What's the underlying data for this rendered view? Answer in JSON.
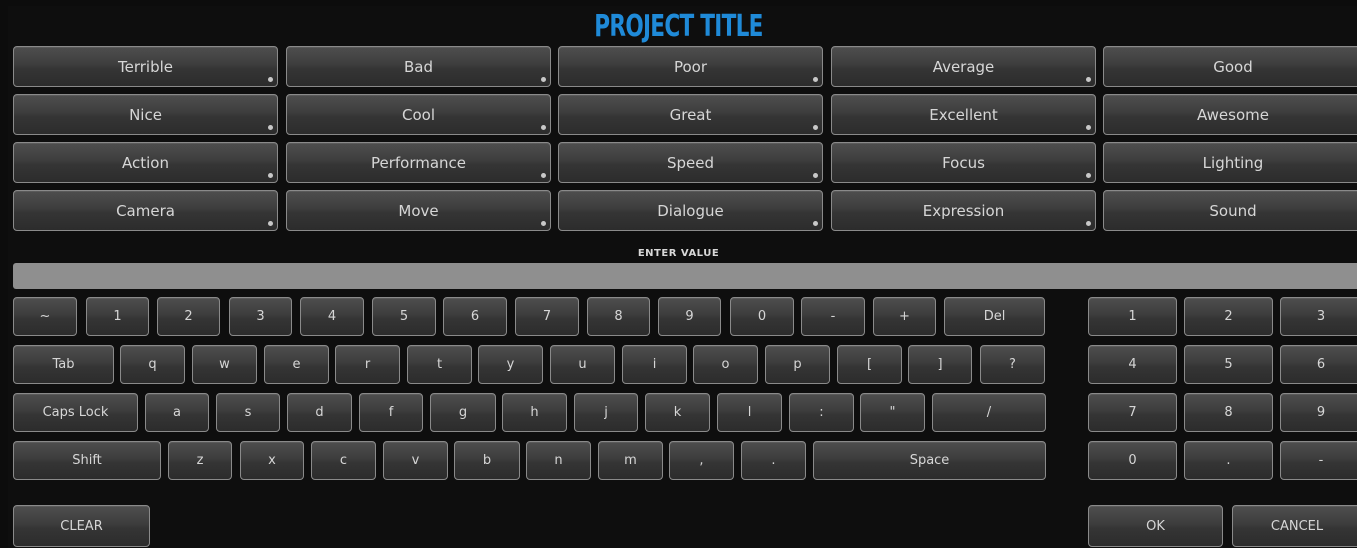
{
  "title": "PROJECT TITLE",
  "presets": [
    [
      "Terrible",
      "Bad",
      "Poor",
      "Average",
      "Good"
    ],
    [
      "Nice",
      "Cool",
      "Great",
      "Excellent",
      "Awesome"
    ],
    [
      "Action",
      "Performance",
      "Speed",
      "Focus",
      "Lighting"
    ],
    [
      "Camera",
      "Move",
      "Dialogue",
      "Expression",
      "Sound"
    ]
  ],
  "enter_value_label": "ENTER VALUE",
  "input_value": "",
  "keyboard": {
    "row1": [
      "~",
      "1",
      "2",
      "3",
      "4",
      "5",
      "6",
      "7",
      "8",
      "9",
      "0",
      "-",
      "+",
      "Del"
    ],
    "row2": [
      "Tab",
      "q",
      "w",
      "e",
      "r",
      "t",
      "y",
      "u",
      "i",
      "o",
      "p",
      "[",
      "]",
      "?"
    ],
    "row3": [
      "Caps Lock",
      "a",
      "s",
      "d",
      "f",
      "g",
      "h",
      "j",
      "k",
      "l",
      ":",
      "\"",
      "/"
    ],
    "row4": [
      "Shift",
      "z",
      "x",
      "c",
      "v",
      "b",
      "n",
      "m",
      ",",
      ".",
      "Space"
    ]
  },
  "numpad": [
    [
      "1",
      "2",
      "3"
    ],
    [
      "4",
      "5",
      "6"
    ],
    [
      "7",
      "8",
      "9"
    ],
    [
      "0",
      ".",
      "-"
    ]
  ],
  "actions": {
    "clear": "CLEAR",
    "ok": "OK",
    "cancel": "CANCEL"
  }
}
